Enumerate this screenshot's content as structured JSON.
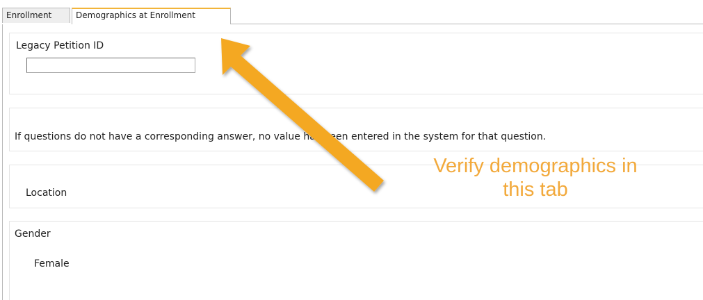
{
  "tabs": [
    {
      "label": "Enrollment",
      "active": false
    },
    {
      "label": "Demographics at Enrollment",
      "active": true
    }
  ],
  "legacy": {
    "label": "Legacy Petition ID",
    "value": ""
  },
  "note": {
    "text": "If questions do not have a corresponding answer, no value has been entered in the system for that question."
  },
  "location": {
    "label": "Location"
  },
  "gender": {
    "label": "Gender",
    "value": "Female"
  },
  "callout": {
    "text": "Verify demographics in\nthis tab",
    "color": "#f2a93b"
  },
  "colors": {
    "tab_accent": "#f2b43a",
    "border": "#b8b8b8"
  }
}
